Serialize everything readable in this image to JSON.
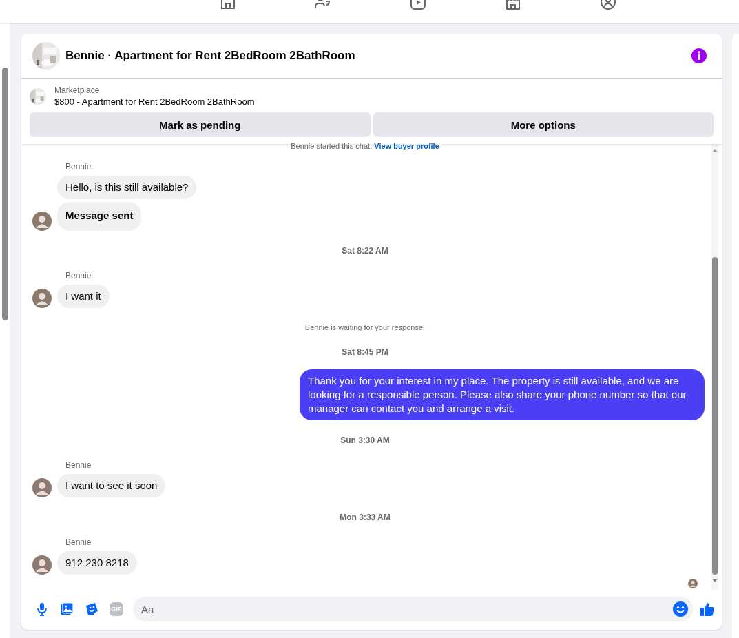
{
  "conversation": {
    "title": "Bennie · Apartment for Rent 2BedRoom 2BathRoom"
  },
  "listing": {
    "source": "Marketplace",
    "title": "$800 - Apartment for Rent 2BedRoom 2BathRoom"
  },
  "actions": [
    "Mark as pending",
    "More options"
  ],
  "messages": [
    {
      "kind": "system",
      "text": "Bennie started this chat.",
      "link": "View buyer profile"
    },
    {
      "kind": "incoming",
      "sender": "Bennie",
      "bubbles": [
        {
          "text": "Hello, is this still available?",
          "bold": false
        },
        {
          "text": "Message sent",
          "bold": true
        }
      ]
    },
    {
      "kind": "timestamp",
      "text": "Sat 8:22 AM"
    },
    {
      "kind": "incoming",
      "sender": "Bennie",
      "bubbles": [
        {
          "text": "I want it",
          "bold": false
        }
      ]
    },
    {
      "kind": "notice",
      "text": "Bennie is waiting for your response."
    },
    {
      "kind": "timestamp",
      "text": "Sat 8:45 PM"
    },
    {
      "kind": "outgoing",
      "bubbles": [
        {
          "text": "Thank you for your interest in my place. The property is still available, and we are looking for a responsible person. Please also share your phone number so that our manager can contact you and arrange a visit.",
          "bold": false
        }
      ]
    },
    {
      "kind": "timestamp",
      "text": "Sun 3:30 AM"
    },
    {
      "kind": "incoming",
      "sender": "Bennie",
      "bubbles": [
        {
          "text": "I want to see it soon",
          "bold": false
        }
      ]
    },
    {
      "kind": "timestamp",
      "text": "Mon 3:33 AM"
    },
    {
      "kind": "incoming",
      "sender": "Bennie",
      "bubbles": [
        {
          "text": "912 230 8218",
          "bold": false
        }
      ]
    }
  ],
  "seen": true,
  "composer": {
    "gif_label": "GIF",
    "placeholder": "Aa"
  }
}
